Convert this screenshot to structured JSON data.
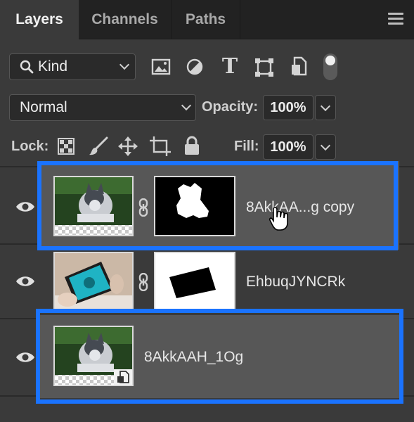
{
  "tabs": {
    "layers": "Layers",
    "channels": "Channels",
    "paths": "Paths"
  },
  "filter": {
    "kind_label": "Kind",
    "icons": [
      "image-filter-icon",
      "adjustment-filter-icon",
      "type-filter-icon",
      "shape-filter-icon",
      "smart-object-filter-icon",
      "filter-toggle-icon"
    ]
  },
  "blend": {
    "mode": "Normal",
    "opacity_label": "Opacity:",
    "opacity_value": "100%"
  },
  "lock": {
    "label": "Lock:",
    "fill_label": "Fill:",
    "fill_value": "100%",
    "icons": [
      "lock-transparent-pixels-icon",
      "lock-image-pixels-icon",
      "lock-position-icon",
      "lock-artboard-icon",
      "lock-all-icon"
    ]
  },
  "layers": [
    {
      "name": "8AkkAA...g copy",
      "visible": true,
      "has_mask": true,
      "highlighted": true,
      "selected": true
    },
    {
      "name": "EhbuqJYNCRk",
      "visible": true,
      "has_mask": true,
      "highlighted": false,
      "selected": false
    },
    {
      "name": "8AkkAAH_1Og",
      "visible": true,
      "has_mask": false,
      "smart_object": true,
      "highlighted": true,
      "selected": true
    }
  ],
  "colors": {
    "highlight": "#1a73ff",
    "panel": "#3a3a3a",
    "selected_row": "#575757"
  }
}
